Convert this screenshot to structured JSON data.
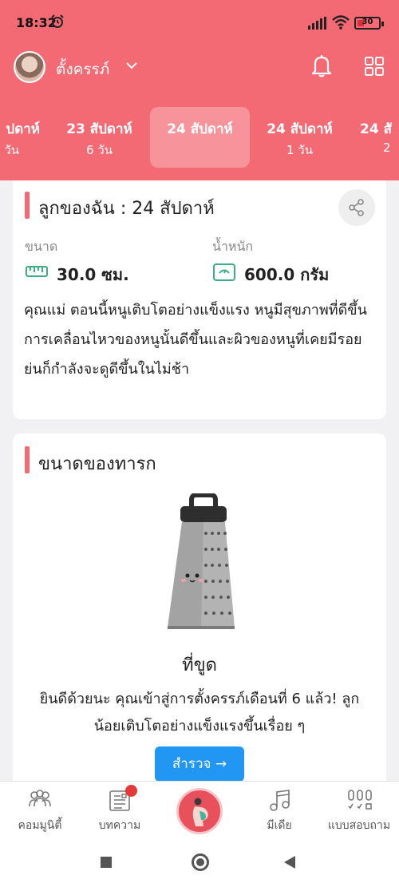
{
  "status_bar": {
    "time": "18:32",
    "battery": "30",
    "battery_level": 0.3
  },
  "header": {
    "profile_name": "ตั้งครรภ์",
    "weeks": [
      {
        "week": "ปดาห์",
        "days": "วัน"
      },
      {
        "week": "23 สัปดาห์",
        "days": "6 วัน"
      },
      {
        "week": "24 สัปดาห์",
        "days": ""
      },
      {
        "week": "24 สัปดาห์",
        "days": "1 วัน"
      },
      {
        "week": "24 สั",
        "days": "2"
      }
    ],
    "active_week_index": 2
  },
  "baby_card": {
    "title": "ลูกของฉัน :  24 สัปดาห์",
    "size_label": "ขนาด",
    "size_value": "30.0 ซม.",
    "weight_label": "น้ำหนัก",
    "weight_value": "600.0 กรัม",
    "description": "คุณแม่ ตอนนี้หนูเติบโตอย่างแข็งแรง หนูมีสุขภาพที่ดีขึ้น การเคลื่อนไหวของหนูนั้นดีขึ้นและผิวของหนูที่เคยมีรอยย่นก็กำลังจะดูดีขึ้นในไม่ช้า"
  },
  "size_card": {
    "title": "ขนาดของทารก",
    "item_name": "ที่ขูด",
    "item_description": "ยินดีด้วยนะ คุณเข้าสู่การตั้งครรภ์เดือนที่ 6 แล้ว! ลูกน้อยเติบโตอย่างแข็งแรงขึ้นเรื่อย ๆ",
    "explore_button": "สำรวจ →"
  },
  "bottom_nav": {
    "community": "คอมมูนิตี้",
    "articles": "บทความ",
    "media": "มีเดีย",
    "quiz": "แบบสอบถาม"
  },
  "colors": {
    "brand": "#f46a74",
    "accent_button": "#2196f3",
    "icon_green": "#3cae80"
  },
  "icons": [
    "alarm-icon",
    "signal-icon",
    "wifi-icon",
    "chevron-down-icon",
    "bell-icon",
    "grid-icon",
    "share-icon",
    "ruler-icon",
    "scale-icon",
    "community-icon",
    "article-icon",
    "pregnancy-icon",
    "music-icon",
    "quiz-icon"
  ]
}
